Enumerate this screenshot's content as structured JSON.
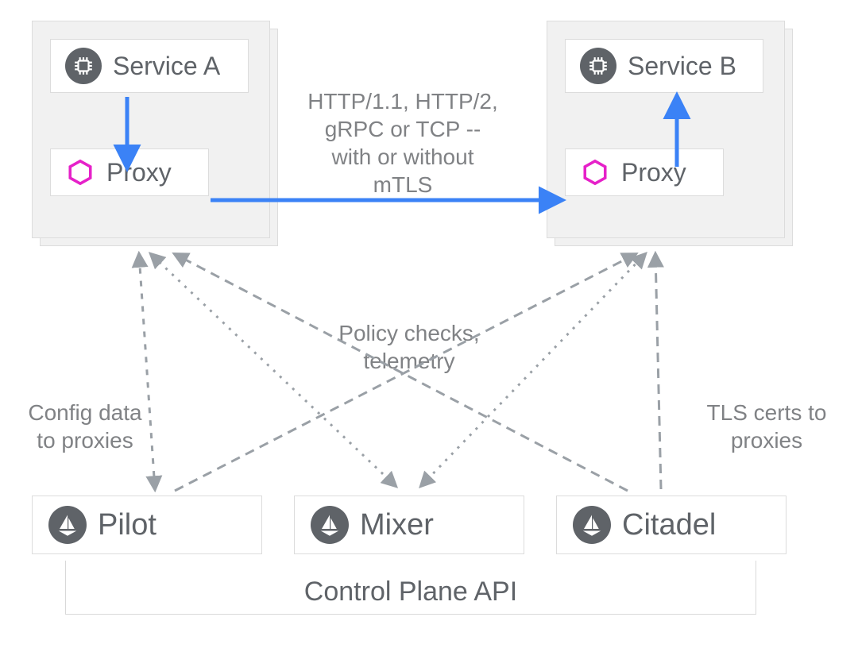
{
  "services": {
    "a": {
      "label": "Service A"
    },
    "b": {
      "label": "Service B"
    }
  },
  "proxy": {
    "label": "Proxy"
  },
  "annotations": {
    "protocol": "HTTP/1.1, HTTP/2,\ngRPC or TCP --\nwith or without\nmTLS",
    "policy": "Policy checks,\ntelemetry",
    "config": "Config data\nto proxies",
    "certs": "TLS certs to\nproxies"
  },
  "control_plane": {
    "pilot": {
      "label": "Pilot"
    },
    "mixer": {
      "label": "Mixer"
    },
    "citadel": {
      "label": "Citadel"
    },
    "api_label": "Control Plane API"
  },
  "colors": {
    "line_blue": "#3b82f6",
    "line_gray": "#9aa0a6",
    "hex_magenta": "#e621c9",
    "icon_bg": "#5f6368"
  }
}
